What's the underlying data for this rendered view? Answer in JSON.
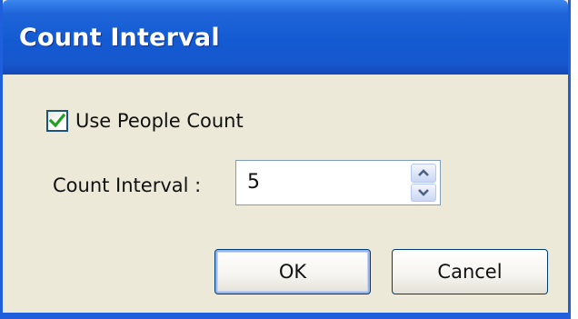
{
  "window": {
    "title": "Count Interval"
  },
  "options": {
    "use_people_count_label": "Use People Count",
    "use_people_count_checked": true
  },
  "interval": {
    "label": "Count Interval :",
    "value": "5"
  },
  "buttons": {
    "ok_label": "OK",
    "cancel_label": "Cancel"
  },
  "icons": {
    "check": "check-icon",
    "spin_up": "arrow-up-icon",
    "spin_down": "arrow-down-icon"
  },
  "colors": {
    "titlebar": "#1f64d8",
    "dialog_face": "#ece9d8",
    "check_mark": "#21a121",
    "spin_arrow": "#4d6185"
  }
}
